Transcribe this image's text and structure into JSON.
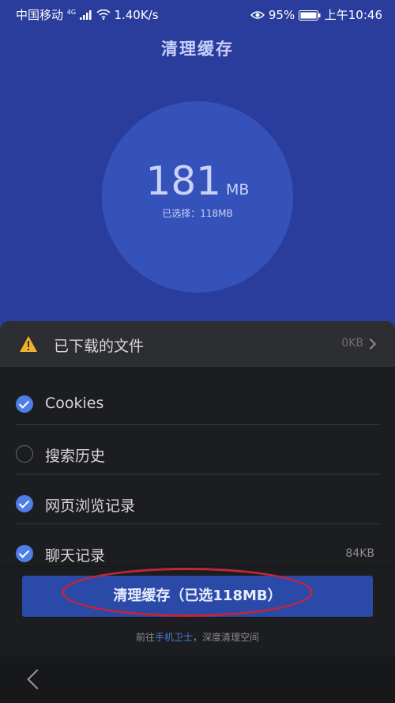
{
  "status": {
    "carrier": "中国移动",
    "network": "4G",
    "speed": "1.40K/s",
    "battery": "95%",
    "time": "上午10:46"
  },
  "header": {
    "title": "清理缓存"
  },
  "summary": {
    "total": "181",
    "unit": "MB",
    "selected_text": "已选择：118MB"
  },
  "downloaded": {
    "label": "已下载的文件",
    "size": "0KB"
  },
  "items": [
    {
      "label": "Cookies",
      "checked": true,
      "size": ""
    },
    {
      "label": "搜索历史",
      "checked": false,
      "size": ""
    },
    {
      "label": "网页浏览记录",
      "checked": true,
      "size": ""
    },
    {
      "label": "聊天记录",
      "checked": true,
      "size": "84KB"
    }
  ],
  "action": {
    "label": "清理缓存（已选118MB）"
  },
  "footer": {
    "prefix": "前往",
    "link": "手机卫士",
    "suffix": "，深度清理空间"
  },
  "colors": {
    "header_bg": "#2b3d9c",
    "accent": "#4e7ee6",
    "highlight_ring": "#c0263b"
  }
}
